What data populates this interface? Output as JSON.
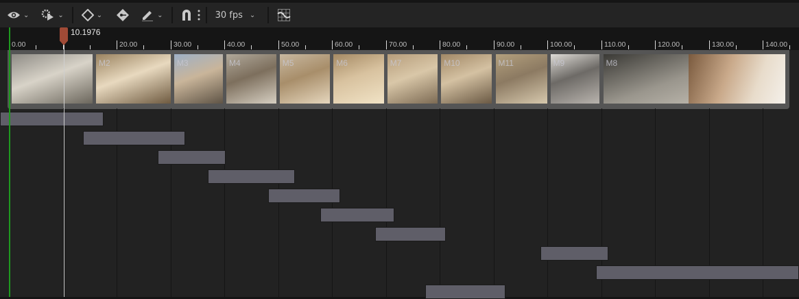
{
  "toolbar": {
    "view_icon": "eye-icon",
    "playback_icon": "gear-play-icon",
    "key_icon": "diamond-key-icon",
    "key_property_icon": "key-tag-icon",
    "edit_icon": "pencil-icon",
    "snap_icon": "magnet-icon",
    "more_icon": "vertical-dots-icon",
    "fps_label": "30 fps",
    "curve_editor_icon": "curve-grid-icon"
  },
  "ruler": {
    "labels": [
      "0.00",
      "",
      "20.00",
      "30.00",
      "40.00",
      "50.00",
      "60.00",
      "70.00",
      "80.00",
      "90.00",
      "100.00",
      "110.00",
      "120.00",
      "130.00",
      "140.00"
    ],
    "major_step": 10
  },
  "playhead": {
    "time": "10.1976",
    "value": 10.1976,
    "color": "#a04a36"
  },
  "sections": [
    {
      "label": "",
      "start": 0,
      "end": 15.8
    },
    {
      "label": "M2",
      "start": 15.8,
      "end": 30.3
    },
    {
      "label": "M3",
      "start": 30.3,
      "end": 40.0
    },
    {
      "label": "M4",
      "start": 40.0,
      "end": 49.9
    },
    {
      "label": "M5",
      "start": 49.9,
      "end": 59.9
    },
    {
      "label": "M6",
      "start": 59.9,
      "end": 69.9
    },
    {
      "label": "M7",
      "start": 69.9,
      "end": 79.9
    },
    {
      "label": "M10",
      "start": 79.9,
      "end": 90.0
    },
    {
      "label": "M11",
      "start": 90.0,
      "end": 100.2
    },
    {
      "label": "M9",
      "start": 100.2,
      "end": 110.0
    },
    {
      "label": "M8",
      "start": 110.0,
      "end": 144.5
    }
  ],
  "shot_bars": [
    {
      "start": -1.7,
      "end": 17.6
    },
    {
      "start": 13.8,
      "end": 32.7
    },
    {
      "start": 27.6,
      "end": 40.3
    },
    {
      "start": 36.9,
      "end": 53.1
    },
    {
      "start": 48.2,
      "end": 61.5
    },
    {
      "start": 57.8,
      "end": 71.6
    },
    {
      "start": 68.0,
      "end": 81.1
    },
    {
      "start": 98.7,
      "end": 111.3
    },
    {
      "start": 109.0,
      "end": 146.8
    },
    {
      "start": 77.3,
      "end": 92.2
    }
  ]
}
